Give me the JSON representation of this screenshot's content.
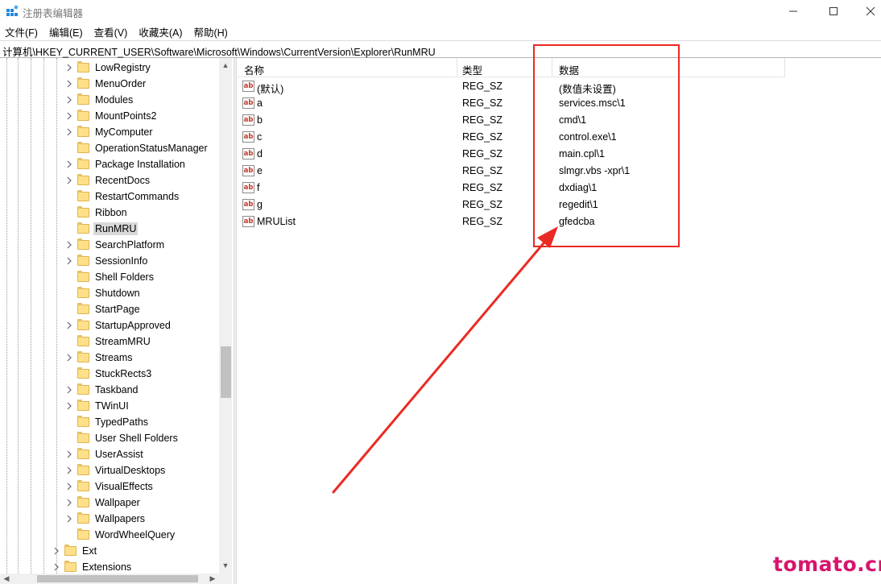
{
  "window": {
    "title": "注册表编辑器",
    "controls": {
      "minimize": "—",
      "maximize": "☐",
      "close": "✕"
    }
  },
  "menu": [
    {
      "label": "文件(F)"
    },
    {
      "label": "编辑(E)"
    },
    {
      "label": "查看(V)"
    },
    {
      "label": "收藏夹(A)"
    },
    {
      "label": "帮助(H)"
    }
  ],
  "address": "计算机\\HKEY_CURRENT_USER\\Software\\Microsoft\\Windows\\CurrentVersion\\Explorer\\RunMRU",
  "tree": {
    "items": [
      {
        "label": "LowRegistry",
        "expandable": true
      },
      {
        "label": "MenuOrder",
        "expandable": true
      },
      {
        "label": "Modules",
        "expandable": true
      },
      {
        "label": "MountPoints2",
        "expandable": true
      },
      {
        "label": "MyComputer",
        "expandable": true
      },
      {
        "label": "OperationStatusManager",
        "expandable": false
      },
      {
        "label": "Package Installation",
        "expandable": true
      },
      {
        "label": "RecentDocs",
        "expandable": true
      },
      {
        "label": "RestartCommands",
        "expandable": false
      },
      {
        "label": "Ribbon",
        "expandable": false
      },
      {
        "label": "RunMRU",
        "expandable": false,
        "selected": true
      },
      {
        "label": "SearchPlatform",
        "expandable": true
      },
      {
        "label": "SessionInfo",
        "expandable": true
      },
      {
        "label": "Shell Folders",
        "expandable": false
      },
      {
        "label": "Shutdown",
        "expandable": false
      },
      {
        "label": "StartPage",
        "expandable": false
      },
      {
        "label": "StartupApproved",
        "expandable": true
      },
      {
        "label": "StreamMRU",
        "expandable": false
      },
      {
        "label": "Streams",
        "expandable": true
      },
      {
        "label": "StuckRects3",
        "expandable": false
      },
      {
        "label": "Taskband",
        "expandable": true
      },
      {
        "label": "TWinUI",
        "expandable": true
      },
      {
        "label": "TypedPaths",
        "expandable": false
      },
      {
        "label": "User Shell Folders",
        "expandable": false
      },
      {
        "label": "UserAssist",
        "expandable": true
      },
      {
        "label": "VirtualDesktops",
        "expandable": true
      },
      {
        "label": "VisualEffects",
        "expandable": true
      },
      {
        "label": "Wallpaper",
        "expandable": true
      },
      {
        "label": "Wallpapers",
        "expandable": true
      },
      {
        "label": "WordWheelQuery",
        "expandable": false
      }
    ],
    "parent_items": [
      {
        "label": "Ext",
        "expandable": true
      },
      {
        "label": "Extensions",
        "expandable": true
      }
    ]
  },
  "list": {
    "columns": {
      "name": "名称",
      "type": "类型",
      "data": "数据"
    },
    "icon_text": "ab",
    "rows": [
      {
        "name": "(默认)",
        "type": "REG_SZ",
        "data": "(数值未设置)"
      },
      {
        "name": "a",
        "type": "REG_SZ",
        "data": "services.msc\\1"
      },
      {
        "name": "b",
        "type": "REG_SZ",
        "data": "cmd\\1"
      },
      {
        "name": "c",
        "type": "REG_SZ",
        "data": "control.exe\\1"
      },
      {
        "name": "d",
        "type": "REG_SZ",
        "data": "main.cpl\\1"
      },
      {
        "name": "e",
        "type": "REG_SZ",
        "data": "slmgr.vbs -xpr\\1"
      },
      {
        "name": "f",
        "type": "REG_SZ",
        "data": "dxdiag\\1"
      },
      {
        "name": "g",
        "type": "REG_SZ",
        "data": "regedit\\1"
      },
      {
        "name": "MRUList",
        "type": "REG_SZ",
        "data": "gfedcba"
      }
    ]
  },
  "annotation": {
    "color": "#ea2a24"
  },
  "watermark": "tomato.cm"
}
